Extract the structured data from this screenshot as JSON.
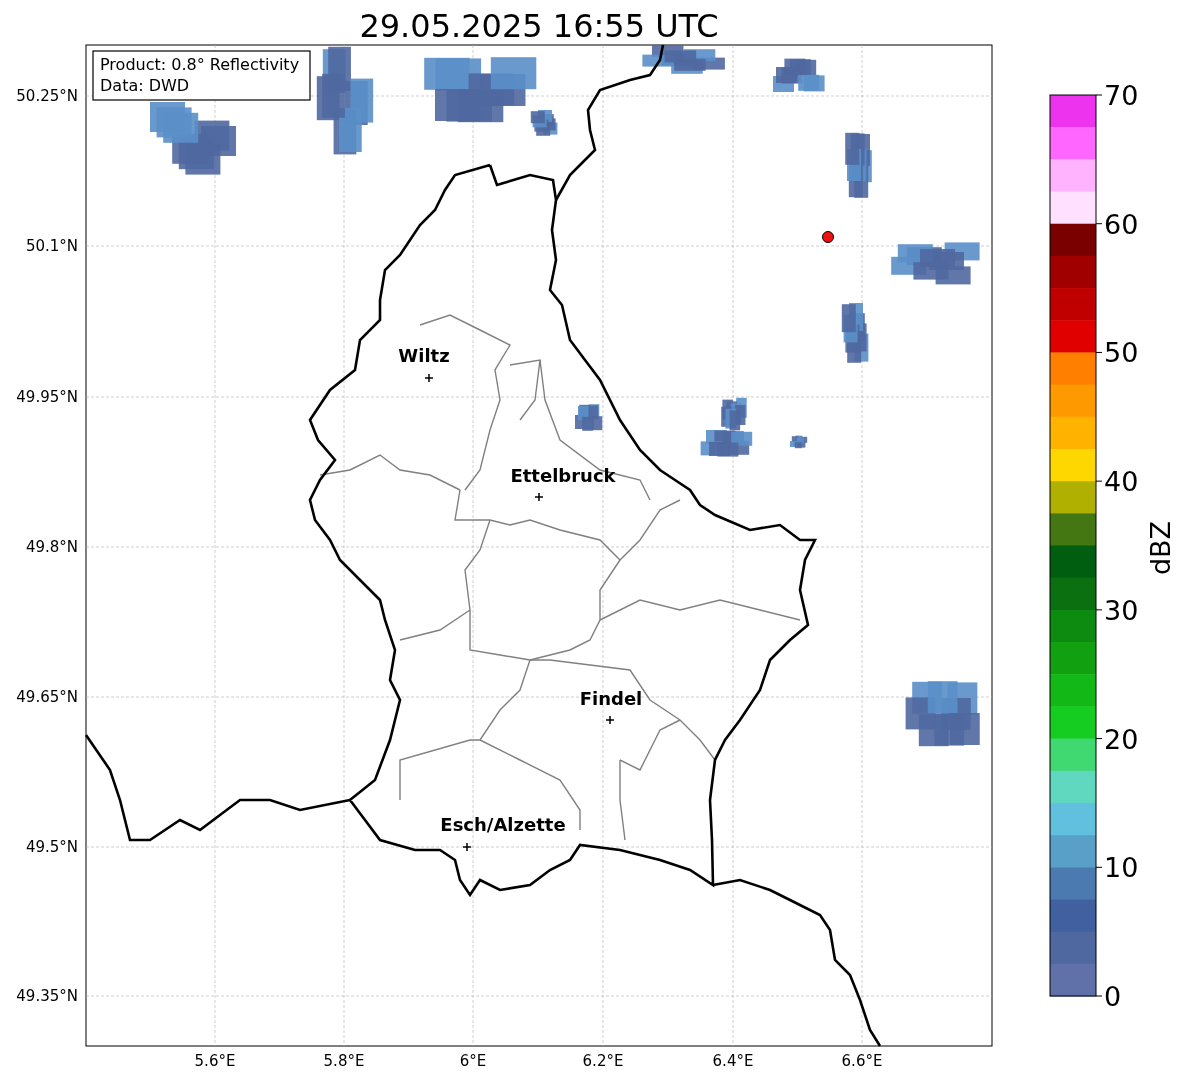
{
  "title": "29.05.2025 16:55 UTC",
  "info_box": [
    "Product: 0.8° Reflectivity",
    "Data: DWD"
  ],
  "cities": [
    {
      "name": "Wiltz"
    },
    {
      "name": "Ettelbruck"
    },
    {
      "name": "Findel"
    },
    {
      "name": "Esch/Alzette"
    }
  ],
  "x_ticks": [
    "5.6°E",
    "5.8°E",
    "6°E",
    "6.2°E",
    "6.4°E",
    "6.6°E"
  ],
  "y_ticks": [
    "50.25°N",
    "50.1°N",
    "49.95°N",
    "49.8°N",
    "49.65°N",
    "49.5°N",
    "49.35°N"
  ],
  "colorbar": {
    "label": "dBZ",
    "ticks": [
      "70",
      "60",
      "50",
      "40",
      "30",
      "20",
      "10",
      "0"
    ],
    "levels": [
      {
        "color": "#ee33ee"
      },
      {
        "color": "#ff66ff"
      },
      {
        "color": "#ffb3ff"
      },
      {
        "color": "#ffe0ff"
      },
      {
        "color": "#7a0000"
      },
      {
        "color": "#a00000"
      },
      {
        "color": "#c00000"
      },
      {
        "color": "#e00000"
      },
      {
        "color": "#ff8000"
      },
      {
        "color": "#ff9900"
      },
      {
        "color": "#ffb300"
      },
      {
        "color": "#ffd700"
      },
      {
        "color": "#b0b000"
      },
      {
        "color": "#447711"
      },
      {
        "color": "#005e10"
      },
      {
        "color": "#0a7010"
      },
      {
        "color": "#0d8a10"
      },
      {
        "color": "#10a010"
      },
      {
        "color": "#12b815"
      },
      {
        "color": "#15cc20"
      },
      {
        "color": "#40d870"
      },
      {
        "color": "#60d8c0"
      },
      {
        "color": "#60c0dd"
      },
      {
        "color": "#58a0c8"
      },
      {
        "color": "#4a7ab0"
      },
      {
        "color": "#4060a0"
      },
      {
        "color": "#5068a0"
      },
      {
        "color": "#6070a8"
      }
    ]
  }
}
